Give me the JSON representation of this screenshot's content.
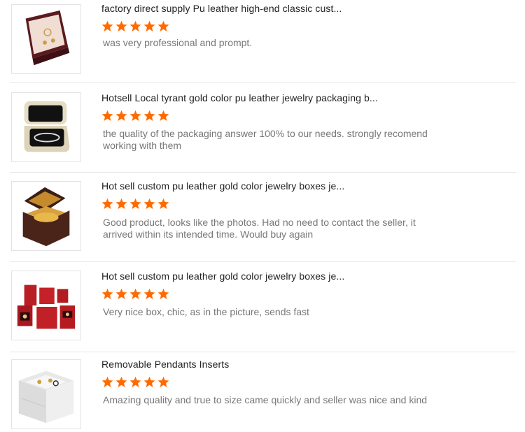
{
  "reviews": [
    {
      "title": "factory direct supply Pu leather high-end classic cust...",
      "rating": 5,
      "comment": "was very professional and prompt.",
      "image_icon": "burgundy-jewelry-box-image"
    },
    {
      "title": "Hotsell Local tyrant gold color pu leather jewelry packaging b...",
      "rating": 5,
      "comment": "the quality of the packaging answer 100% to our needs. strongly recomend working with them",
      "image_icon": "gold-bracelet-box-image"
    },
    {
      "title": "Hot sell custom pu leather gold color jewelry boxes je...",
      "rating": 5,
      "comment": "Good product, looks like the photos. Had no need to contact the seller, it arrived within its intended time. Would buy again",
      "image_icon": "brown-gold-jewelry-box-image"
    },
    {
      "title": "Hot sell custom pu leather gold color jewelry boxes je...",
      "rating": 5,
      "comment": "Very nice box, chic, as in the picture, sends fast",
      "image_icon": "red-jewelry-box-set-image"
    },
    {
      "title": "Removable Pendants Inserts",
      "rating": 5,
      "comment": "Amazing quality and true to size came quickly and seller was nice and kind",
      "image_icon": "white-jewelry-organizer-image"
    }
  ],
  "colors": {
    "star": "#ff6a00",
    "divider": "#e6e6e6",
    "title": "#222222",
    "comment": "#777777"
  }
}
